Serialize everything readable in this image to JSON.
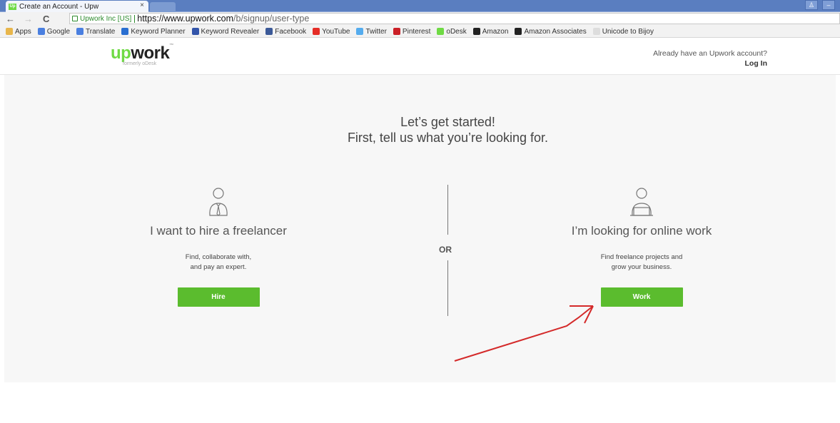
{
  "browser": {
    "tab_title": "Create an Account - Upw",
    "tab_favicon": "Up",
    "tab_close": "×",
    "url_secure_label": "Upwork Inc [US]",
    "url_host": "https://www.upwork.com",
    "url_path": "/b/signup/user-type",
    "bookmarks": [
      {
        "label": "Apps",
        "color": "#e8b64b"
      },
      {
        "label": "Google",
        "color": "#4a7fe0"
      },
      {
        "label": "Translate",
        "color": "#4a7fe0"
      },
      {
        "label": "Keyword Planner",
        "color": "#2a6fd1"
      },
      {
        "label": "Keyword Revealer",
        "color": "#3355aa"
      },
      {
        "label": "Facebook",
        "color": "#3b5998"
      },
      {
        "label": "YouTube",
        "color": "#e52d27"
      },
      {
        "label": "Twitter",
        "color": "#55acee"
      },
      {
        "label": "Pinterest",
        "color": "#cb2027"
      },
      {
        "label": "oDesk",
        "color": "#6fda44"
      },
      {
        "label": "Amazon",
        "color": "#222222"
      },
      {
        "label": "Amazon Associates",
        "color": "#222222"
      },
      {
        "label": "Unicode to Bijoy",
        "color": "#dddddd"
      }
    ]
  },
  "header": {
    "logo_up": "up",
    "logo_rest": "work",
    "logo_tm": "™",
    "formerly": "formerly oDesk",
    "already_text": "Already have an Upwork account?",
    "login_label": "Log In"
  },
  "intro": {
    "line1": "Let’s get started!",
    "line2": "First, tell us what you’re looking for."
  },
  "or_label": "OR",
  "hire": {
    "title": "I want to hire a freelancer",
    "desc_line1": "Find, collaborate with,",
    "desc_line2": "and pay an expert.",
    "button_label": "Hire"
  },
  "work": {
    "title": "I’m looking for online work",
    "desc_line1": "Find freelance projects and",
    "desc_line2": "grow your business.",
    "button_label": "Work"
  },
  "colors": {
    "brand_green": "#6fda44",
    "button_green": "#5bbc2e",
    "annotation_arrow": "#d42a2a"
  }
}
